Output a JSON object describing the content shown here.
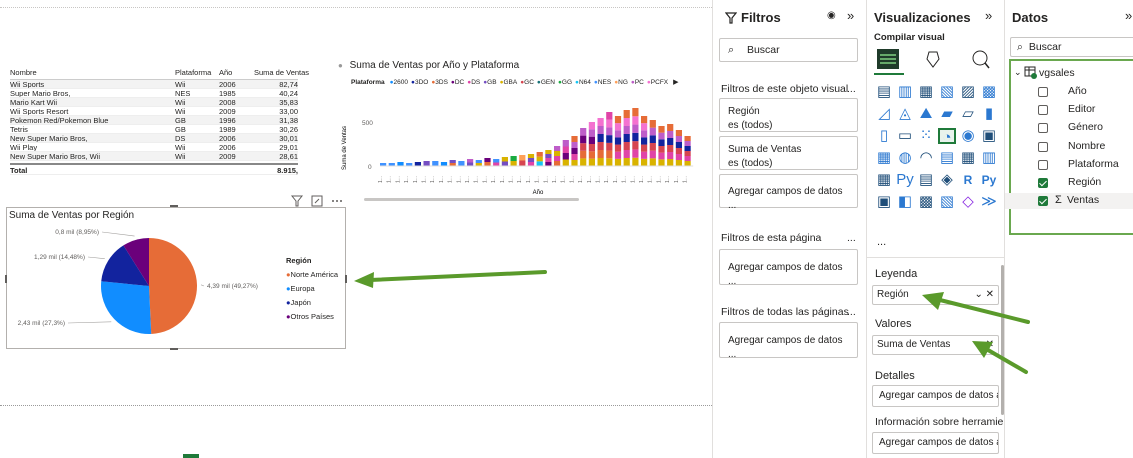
{
  "table": {
    "headers": [
      "Nombre",
      "Plataforma",
      "Año",
      "Suma de Ventas"
    ],
    "rows": [
      [
        "Wii Sports",
        "Wii",
        "2006",
        "82,74"
      ],
      [
        "Super Mario Bros,",
        "NES",
        "1985",
        "40,24"
      ],
      [
        "Mario Kart Wii",
        "Wii",
        "2008",
        "35,83"
      ],
      [
        "Wii Sports Resort",
        "Wii",
        "2009",
        "33,00"
      ],
      [
        "Pokemon Red/Pokemon Blue",
        "GB",
        "1996",
        "31,38"
      ],
      [
        "Tetris",
        "GB",
        "1989",
        "30,26"
      ],
      [
        "New Super Mario Bros,",
        "DS",
        "2006",
        "30,01"
      ],
      [
        "Wii Play",
        "Wii",
        "2006",
        "29,01"
      ],
      [
        "New Super Mario Bros, Wii",
        "Wii",
        "2009",
        "28,61"
      ]
    ],
    "total_label": "Total",
    "total_value": "8.915,"
  },
  "bar_chart": {
    "title": "Suma de Ventas por Año y Plataforma",
    "legend_title": "Plataforma",
    "legend": [
      {
        "name": "2600",
        "color": "#118DFF"
      },
      {
        "name": "3DO",
        "color": "#12239E"
      },
      {
        "name": "3DS",
        "color": "#E66C37"
      },
      {
        "name": "DC",
        "color": "#6B007B"
      },
      {
        "name": "DS",
        "color": "#E044A7"
      },
      {
        "name": "GB",
        "color": "#744EC2"
      },
      {
        "name": "GBA",
        "color": "#D9B300"
      },
      {
        "name": "GC",
        "color": "#D64550"
      },
      {
        "name": "GEN",
        "color": "#197278"
      },
      {
        "name": "GG",
        "color": "#1AAB40"
      },
      {
        "name": "N64",
        "color": "#15C6F4"
      },
      {
        "name": "NES",
        "color": "#4092FF"
      },
      {
        "name": "NG",
        "color": "#FFA058"
      },
      {
        "name": "PC",
        "color": "#BE5DC9"
      },
      {
        "name": "PCFX",
        "color": "#F472D0"
      }
    ],
    "ylabel": "Suma de Ventas",
    "xlabel": "Año",
    "yticks": [
      "500",
      "0"
    ],
    "xtick": "1..."
  },
  "chart_data": {
    "type": "pie",
    "title": "Suma de Ventas por Región",
    "legend_title": "Región",
    "slices": [
      {
        "name": "Norte América",
        "value": 4390,
        "percent": 49.27,
        "label": "4,39 mil (49,27%)",
        "color": "#E66C37"
      },
      {
        "name": "Europa",
        "value": 2430,
        "percent": 27.3,
        "label": "2,43 mil (27,3%)",
        "color": "#118DFF"
      },
      {
        "name": "Japón",
        "value": 1290,
        "percent": 14.48,
        "label": "1,29 mil (14,48%)",
        "color": "#12239E"
      },
      {
        "name": "Otros Países",
        "value": 800,
        "percent": 8.95,
        "label": "0,8 mil (8,95%)",
        "color": "#6B007B"
      }
    ],
    "legend_position": "right"
  },
  "filters": {
    "title": "Filtros",
    "search_placeholder": "Buscar",
    "visual_section": "Filtros de este objeto visual",
    "region_title": "Región",
    "region_value": "es (todos)",
    "sales_title": "Suma de Ventas",
    "sales_value": "es (todos)",
    "add_fields": "Agregar campos de datos ...",
    "page_section": "Filtros de esta página",
    "all_pages_section": "Filtros de todas las páginas",
    "more": "..."
  },
  "visualizations": {
    "title": "Visualizaciones",
    "subtitle": "Compilar visual",
    "more": "...",
    "legend_label": "Leyenda",
    "legend_field": "Región",
    "values_label": "Valores",
    "values_field": "Suma de Ventas",
    "details_label": "Detalles",
    "details_add": "Agregar campos de datos a...",
    "tooltips_label": "Información sobre herramien...",
    "tooltips_add": "Agregar campos de datos a...",
    "py": "Py",
    "r": "R"
  },
  "data_pane": {
    "title": "Datos",
    "search_placeholder": "Buscar",
    "table_name": "vgsales",
    "fields": [
      {
        "name": "Año",
        "checked": false
      },
      {
        "name": "Editor",
        "checked": false
      },
      {
        "name": "Género",
        "checked": false
      },
      {
        "name": "Nombre",
        "checked": false
      },
      {
        "name": "Plataforma",
        "checked": false
      },
      {
        "name": "Región",
        "checked": true
      },
      {
        "name": "Ventas",
        "checked": true,
        "sigma": true
      }
    ]
  }
}
